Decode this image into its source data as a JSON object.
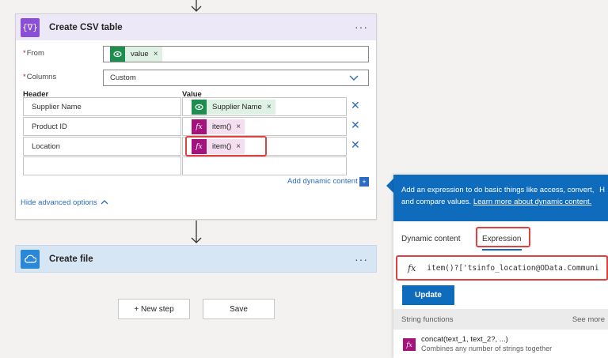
{
  "csv_card": {
    "title": "Create CSV table",
    "menu": "···",
    "from_label": "From",
    "from_token": "value",
    "columns_label": "Columns",
    "columns_value": "Custom",
    "header_col": "Header",
    "value_col": "Value",
    "rows": [
      {
        "header": "Supplier Name",
        "value": "Supplier Name",
        "kind": "dynamic"
      },
      {
        "header": "Product ID",
        "value": "item()",
        "kind": "expression"
      },
      {
        "header": "Location",
        "value": "item()",
        "kind": "expression"
      }
    ],
    "add_dynamic": "Add dynamic content",
    "hide_advanced": "Hide advanced options"
  },
  "file_card": {
    "title": "Create file",
    "menu": "···"
  },
  "buttons": {
    "new_step": "+ New step",
    "save": "Save"
  },
  "panel": {
    "info_text": "Add an expression to do basic things like access, convert, and compare values.",
    "learn_more": "Learn more about dynamic content.",
    "more": "H",
    "tab_dynamic": "Dynamic content",
    "tab_expression": "Expression",
    "fx": "fx",
    "expression": "item()?['tsinfo_location@OData.Communi",
    "update": "Update",
    "section": "String functions",
    "see_more": "See more",
    "func_name": "concat(text_1, text_2?, ...)",
    "func_desc": "Combines any number of strings together"
  },
  "token_x": "×",
  "remove_x": "✕",
  "colors": {
    "accent": "#0f6cbd",
    "highlight": "#e04040",
    "dynamic_token": "#1e8e4e",
    "expression_token": "#a4127d"
  }
}
